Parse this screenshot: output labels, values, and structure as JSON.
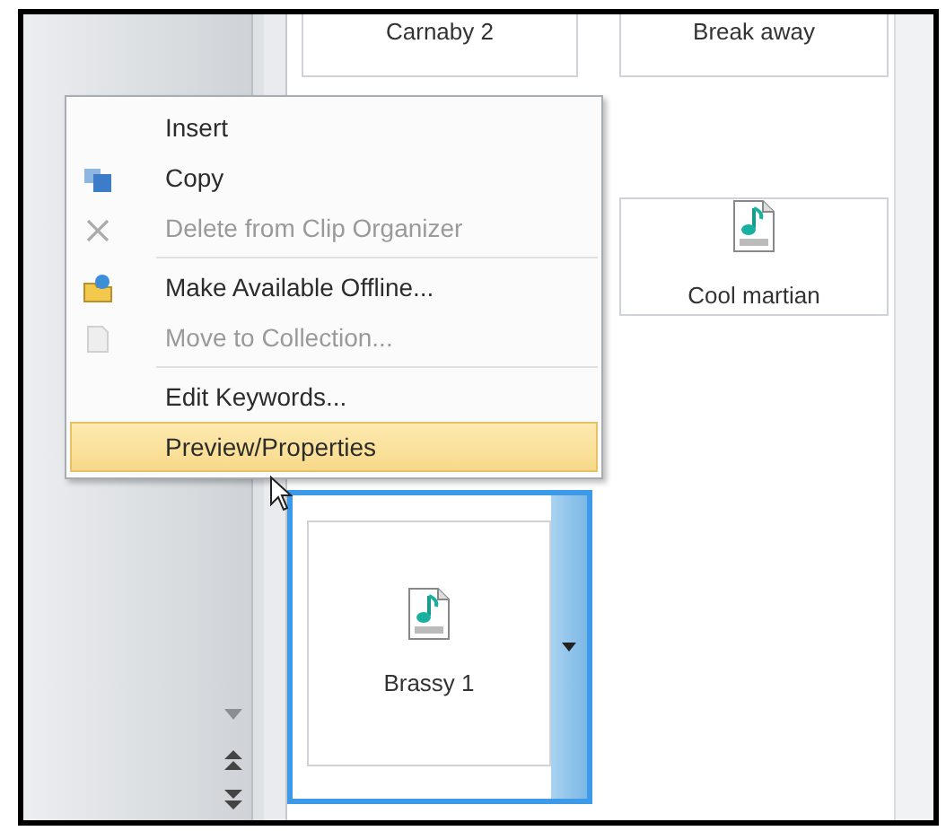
{
  "clips": [
    {
      "name": "Carnaby 2",
      "kind": "text",
      "selected": false
    },
    {
      "name": "Break away",
      "kind": "text",
      "selected": false
    },
    {
      "name": "Cool martian",
      "kind": "sound",
      "selected": false
    },
    {
      "name": "Brassy 1",
      "kind": "sound",
      "selected": true
    }
  ],
  "context_menu": {
    "groups": [
      [
        {
          "label": "Insert",
          "disabled": false,
          "selected": false
        },
        {
          "label": "Copy",
          "disabled": false,
          "selected": false
        },
        {
          "label": "Delete from Clip Organizer",
          "disabled": true,
          "selected": false
        }
      ],
      [
        {
          "label": "Make Available Offline...",
          "disabled": false,
          "selected": false
        },
        {
          "label": "Move to Collection...",
          "disabled": true,
          "selected": false
        }
      ],
      [
        {
          "label": "Edit Keywords...",
          "disabled": false,
          "selected": false
        },
        {
          "label": "Preview/Properties",
          "disabled": false,
          "selected": true
        }
      ]
    ]
  }
}
